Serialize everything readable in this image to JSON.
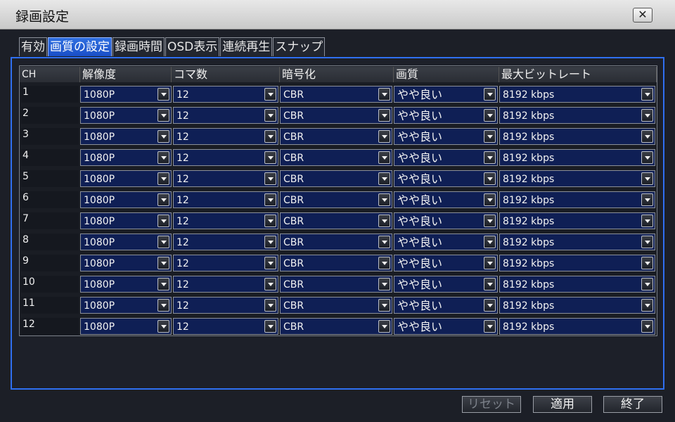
{
  "window": {
    "title": "録画設定",
    "close_label": "✕"
  },
  "tabs": [
    "有効",
    "画質の設定",
    "録画時間",
    "OSD表示",
    "連続再生",
    "スナップ"
  ],
  "table": {
    "headers": [
      "CH",
      "解像度",
      "コマ数",
      "暗号化",
      "画質",
      "最大ビットレート"
    ],
    "rows": [
      {
        "ch": "1",
        "resolution": "1080P",
        "frames": "12",
        "encoding": "CBR",
        "quality": "やや良い",
        "bitrate": "8192 kbps"
      },
      {
        "ch": "2",
        "resolution": "1080P",
        "frames": "12",
        "encoding": "CBR",
        "quality": "やや良い",
        "bitrate": "8192 kbps"
      },
      {
        "ch": "3",
        "resolution": "1080P",
        "frames": "12",
        "encoding": "CBR",
        "quality": "やや良い",
        "bitrate": "8192 kbps"
      },
      {
        "ch": "4",
        "resolution": "1080P",
        "frames": "12",
        "encoding": "CBR",
        "quality": "やや良い",
        "bitrate": "8192 kbps"
      },
      {
        "ch": "5",
        "resolution": "1080P",
        "frames": "12",
        "encoding": "CBR",
        "quality": "やや良い",
        "bitrate": "8192 kbps"
      },
      {
        "ch": "6",
        "resolution": "1080P",
        "frames": "12",
        "encoding": "CBR",
        "quality": "やや良い",
        "bitrate": "8192 kbps"
      },
      {
        "ch": "7",
        "resolution": "1080P",
        "frames": "12",
        "encoding": "CBR",
        "quality": "やや良い",
        "bitrate": "8192 kbps"
      },
      {
        "ch": "8",
        "resolution": "1080P",
        "frames": "12",
        "encoding": "CBR",
        "quality": "やや良い",
        "bitrate": "8192 kbps"
      },
      {
        "ch": "9",
        "resolution": "1080P",
        "frames": "12",
        "encoding": "CBR",
        "quality": "やや良い",
        "bitrate": "8192 kbps"
      },
      {
        "ch": "10",
        "resolution": "1080P",
        "frames": "12",
        "encoding": "CBR",
        "quality": "やや良い",
        "bitrate": "8192 kbps"
      },
      {
        "ch": "11",
        "resolution": "1080P",
        "frames": "12",
        "encoding": "CBR",
        "quality": "やや良い",
        "bitrate": "8192 kbps"
      },
      {
        "ch": "12",
        "resolution": "1080P",
        "frames": "12",
        "encoding": "CBR",
        "quality": "やや良い",
        "bitrate": "8192 kbps"
      }
    ]
  },
  "buttons": {
    "reset": "リセット",
    "apply": "適用",
    "exit": "終了"
  },
  "colors": {
    "accent": "#2f6ff0",
    "select_bg": "#0f1f55",
    "active_tab": "#1a4fc8"
  }
}
